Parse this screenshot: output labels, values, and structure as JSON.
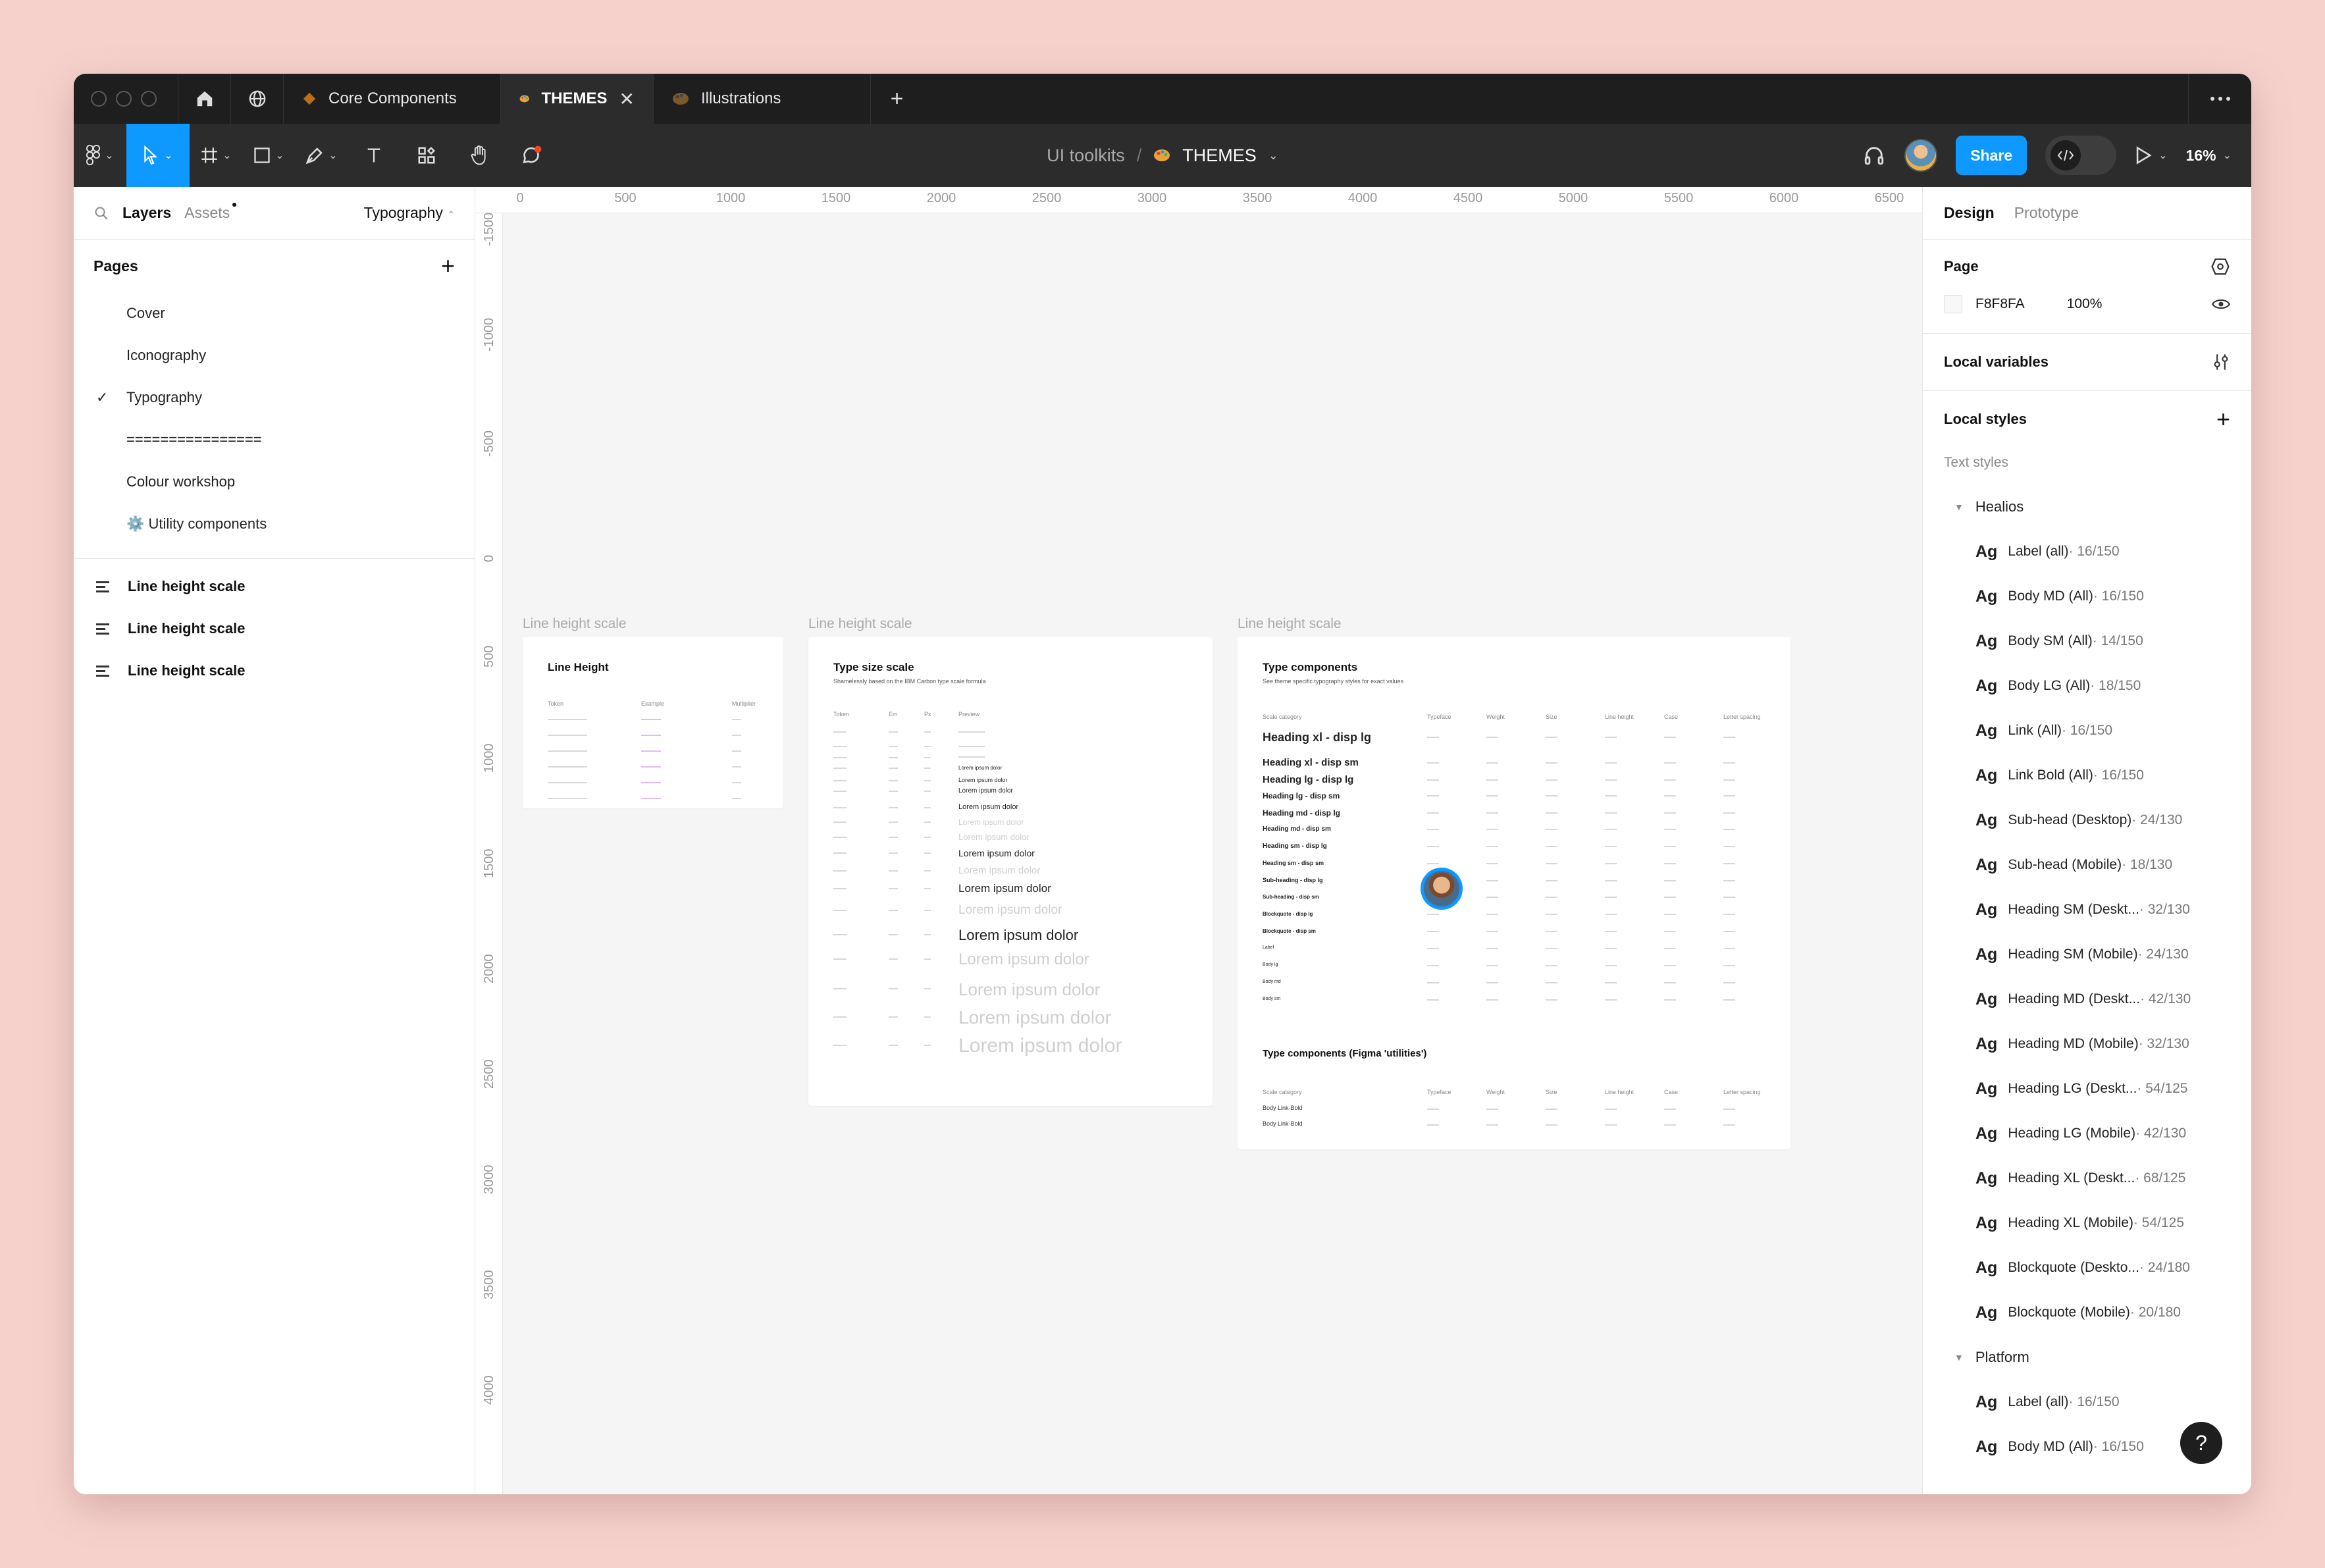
{
  "tabs": [
    {
      "label": "Core Components",
      "icon": "component-diamond-icon"
    },
    {
      "label": "THEMES",
      "icon": "palette-icon",
      "active": true
    },
    {
      "label": "Illustrations",
      "icon": "palette-icon"
    }
  ],
  "breadcrumb": {
    "project": "UI toolkits",
    "separator": "/",
    "file": "THEMES"
  },
  "toolbar": {
    "share_label": "Share",
    "zoom": "16%"
  },
  "left_panel": {
    "tab_layers": "Layers",
    "tab_assets": "Assets",
    "current_page": "Typography",
    "pages_heading": "Pages",
    "pages": [
      "Cover",
      "Iconography",
      "Typography",
      "================",
      "Colour workshop",
      "⚙️ Utility components"
    ],
    "layers": [
      "Line height scale",
      "Line height scale",
      "Line height scale"
    ]
  },
  "rulers": {
    "top": [
      "0",
      "500",
      "1000",
      "1500",
      "2000",
      "2500",
      "3000",
      "3500",
      "4000",
      "4500",
      "5000",
      "5500",
      "6000",
      "6500"
    ],
    "left": [
      "-1500",
      "-1000",
      "-500",
      "0",
      "500",
      "1000",
      "1500",
      "2000",
      "2500",
      "3000",
      "3500",
      "4000"
    ]
  },
  "canvas": {
    "frame_labels": [
      "Line height scale",
      "Line height scale",
      "Line height scale"
    ],
    "frame1": {
      "title": "Line Height",
      "headers": [
        "Token",
        "Example",
        "Multiplier"
      ]
    },
    "frame2": {
      "title": "Type size scale",
      "subtitle": "Shamelessly based on the IBM Carbon type scale formula",
      "headers": [
        "Token",
        "Em",
        "Px",
        "Preview"
      ],
      "previews": [
        "Lorem ipsum dolor",
        "Lorem ipsum dolor",
        "Lorem ipsum dolor",
        "Lorem ipsum dolor",
        "Lorem ipsum dolor",
        "Lorem ipsum dolor",
        "Lorem ipsum dolor",
        "Lorem ipsum dolor",
        "Lorem ipsum dolor",
        "Lorem ipsum dolor",
        "Lorem ipsum dolor",
        "Lorem ipsum dolor",
        "Lorem ipsum dolor",
        "Lorem ipsum dolor",
        "Lorem ipsum dolor"
      ]
    },
    "frame3": {
      "title": "Type components",
      "subtitle": "See theme specific typography styles for exact values",
      "headers": [
        "Scale category",
        "Typeface",
        "Weight",
        "Size",
        "Line height",
        "Case",
        "Letter spacing"
      ],
      "rows": [
        "Heading xl - disp lg",
        "Heading xl - disp sm",
        "Heading lg - disp lg",
        "Heading lg - disp sm",
        "Heading md - disp lg",
        "Heading md - disp sm",
        "Heading sm - disp lg",
        "Heading sm - disp sm",
        "Sub-heading - disp lg",
        "Sub-heading - disp sm",
        "Blockquote - disp lg",
        "Blockquote - disp sm",
        "Label",
        "Body lg",
        "Body md",
        "Body sm"
      ],
      "title2": "Type components (Figma 'utilities')",
      "rows2": [
        "Body Link-Bold",
        "Body Link-Bold"
      ]
    }
  },
  "right_panel": {
    "tab_design": "Design",
    "tab_prototype": "Prototype",
    "page_heading": "Page",
    "page_color": "F8F8FA",
    "page_opacity": "100%",
    "local_variables": "Local variables",
    "local_styles": "Local styles",
    "text_styles": "Text styles",
    "groups": [
      {
        "name": "Healios",
        "styles": [
          {
            "name": "Label (all)",
            "meta": " · 16/150"
          },
          {
            "name": "Body MD (All)",
            "meta": " · 16/150"
          },
          {
            "name": "Body SM (All)",
            "meta": " · 14/150"
          },
          {
            "name": "Body LG (All)",
            "meta": " · 18/150"
          },
          {
            "name": "Link (All)",
            "meta": " · 16/150"
          },
          {
            "name": "Link Bold (All)",
            "meta": " · 16/150"
          },
          {
            "name": "Sub-head (Desktop)",
            "meta": " · 24/130"
          },
          {
            "name": "Sub-head (Mobile)",
            "meta": " · 18/130"
          },
          {
            "name": "Heading SM (Deskt...",
            "meta": " · 32/130"
          },
          {
            "name": "Heading SM (Mobile)",
            "meta": " · 24/130"
          },
          {
            "name": "Heading MD (Deskt...",
            "meta": " · 42/130"
          },
          {
            "name": "Heading MD (Mobile)",
            "meta": " · 32/130"
          },
          {
            "name": "Heading LG (Deskt...",
            "meta": " · 54/125"
          },
          {
            "name": "Heading LG (Mobile)",
            "meta": " · 42/130"
          },
          {
            "name": "Heading XL (Deskt...",
            "meta": " · 68/125"
          },
          {
            "name": "Heading XL (Mobile)",
            "meta": " · 54/125"
          },
          {
            "name": "Blockquote (Deskto...",
            "meta": " · 24/180"
          },
          {
            "name": "Blockquote (Mobile)",
            "meta": " · 20/180"
          }
        ]
      },
      {
        "name": "Platform",
        "styles": [
          {
            "name": "Label (all)",
            "meta": " · 16/150"
          },
          {
            "name": "Body MD (All)",
            "meta": " · 16/150"
          }
        ]
      }
    ],
    "ag": "Ag",
    "help": "?"
  },
  "colors": {
    "accent": "#0d99ff",
    "chrome": "#2c2c2c",
    "tabbar": "#1e1e1e",
    "desk": "#f6d1cc",
    "canvas": "#f5f5f5"
  }
}
